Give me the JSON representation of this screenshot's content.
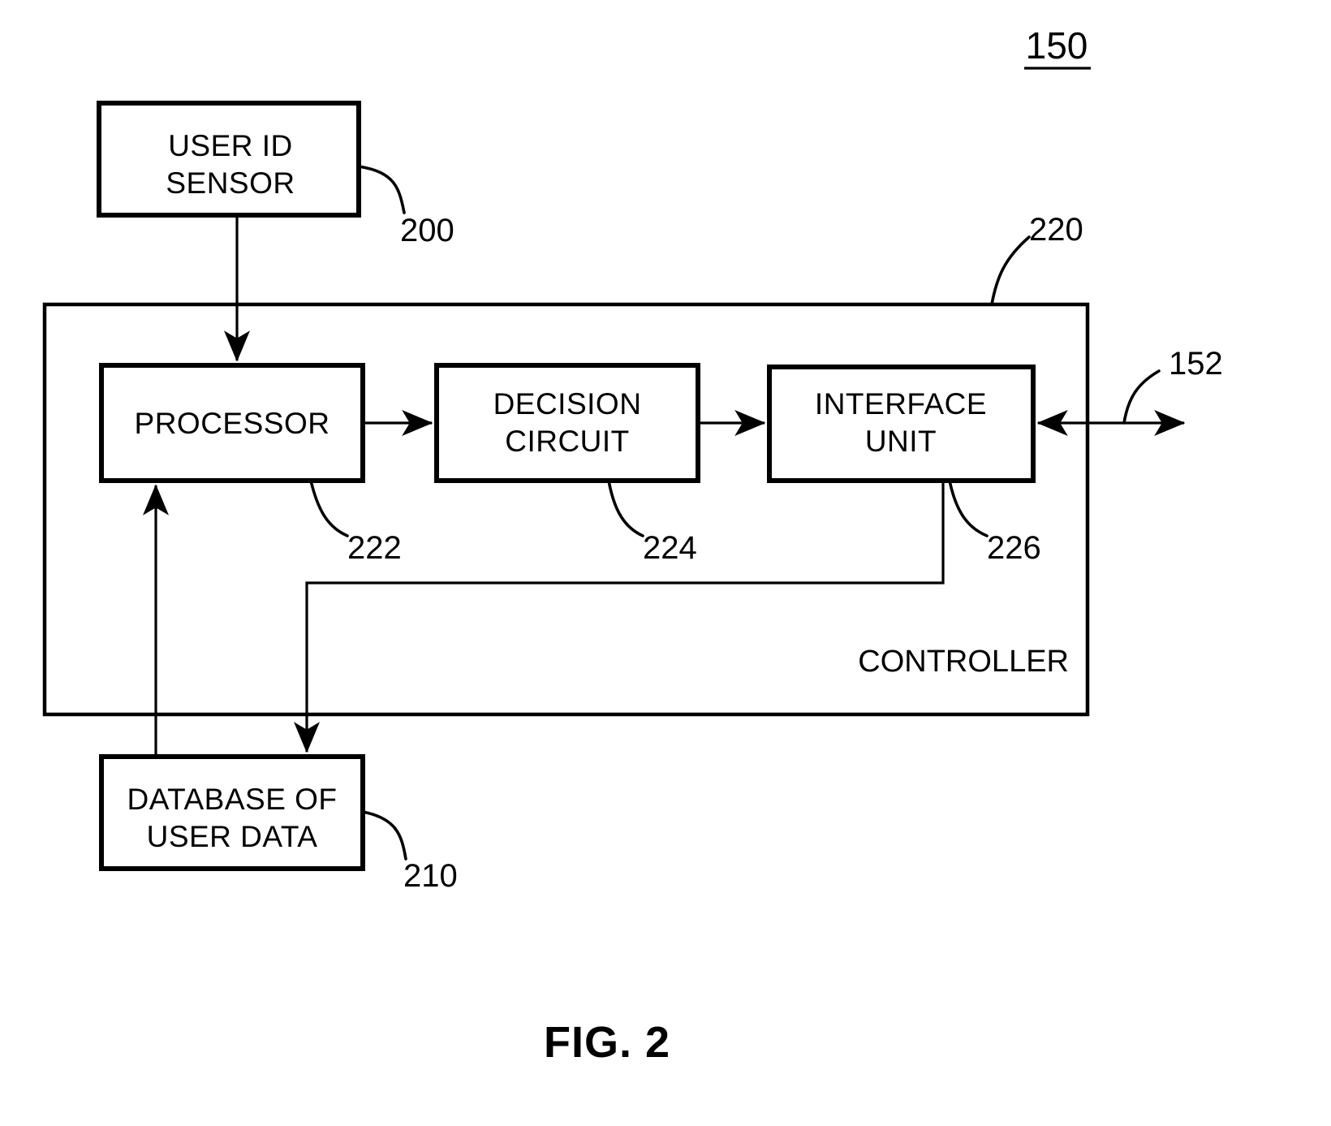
{
  "figure": {
    "caption": "FIG. 2",
    "system_ref": "150"
  },
  "blocks": [
    {
      "id": "user-id-sensor",
      "lines": [
        "USER ID",
        "SENSOR"
      ],
      "ref": "200"
    },
    {
      "id": "processor",
      "lines": [
        "PROCESSOR"
      ],
      "ref": "222"
    },
    {
      "id": "decision-circuit",
      "lines": [
        "DECISION",
        "CIRCUIT"
      ],
      "ref": "224"
    },
    {
      "id": "interface-unit",
      "lines": [
        "INTERFACE",
        "UNIT"
      ],
      "ref": "226"
    },
    {
      "id": "database-of-user-data",
      "lines": [
        "DATABASE OF",
        "USER DATA"
      ],
      "ref": "210"
    }
  ],
  "controller": {
    "label": "CONTROLLER",
    "ref": "220"
  },
  "external_link": {
    "ref": "152"
  },
  "colors": {
    "ink": "#000000",
    "paper": "#ffffff"
  }
}
